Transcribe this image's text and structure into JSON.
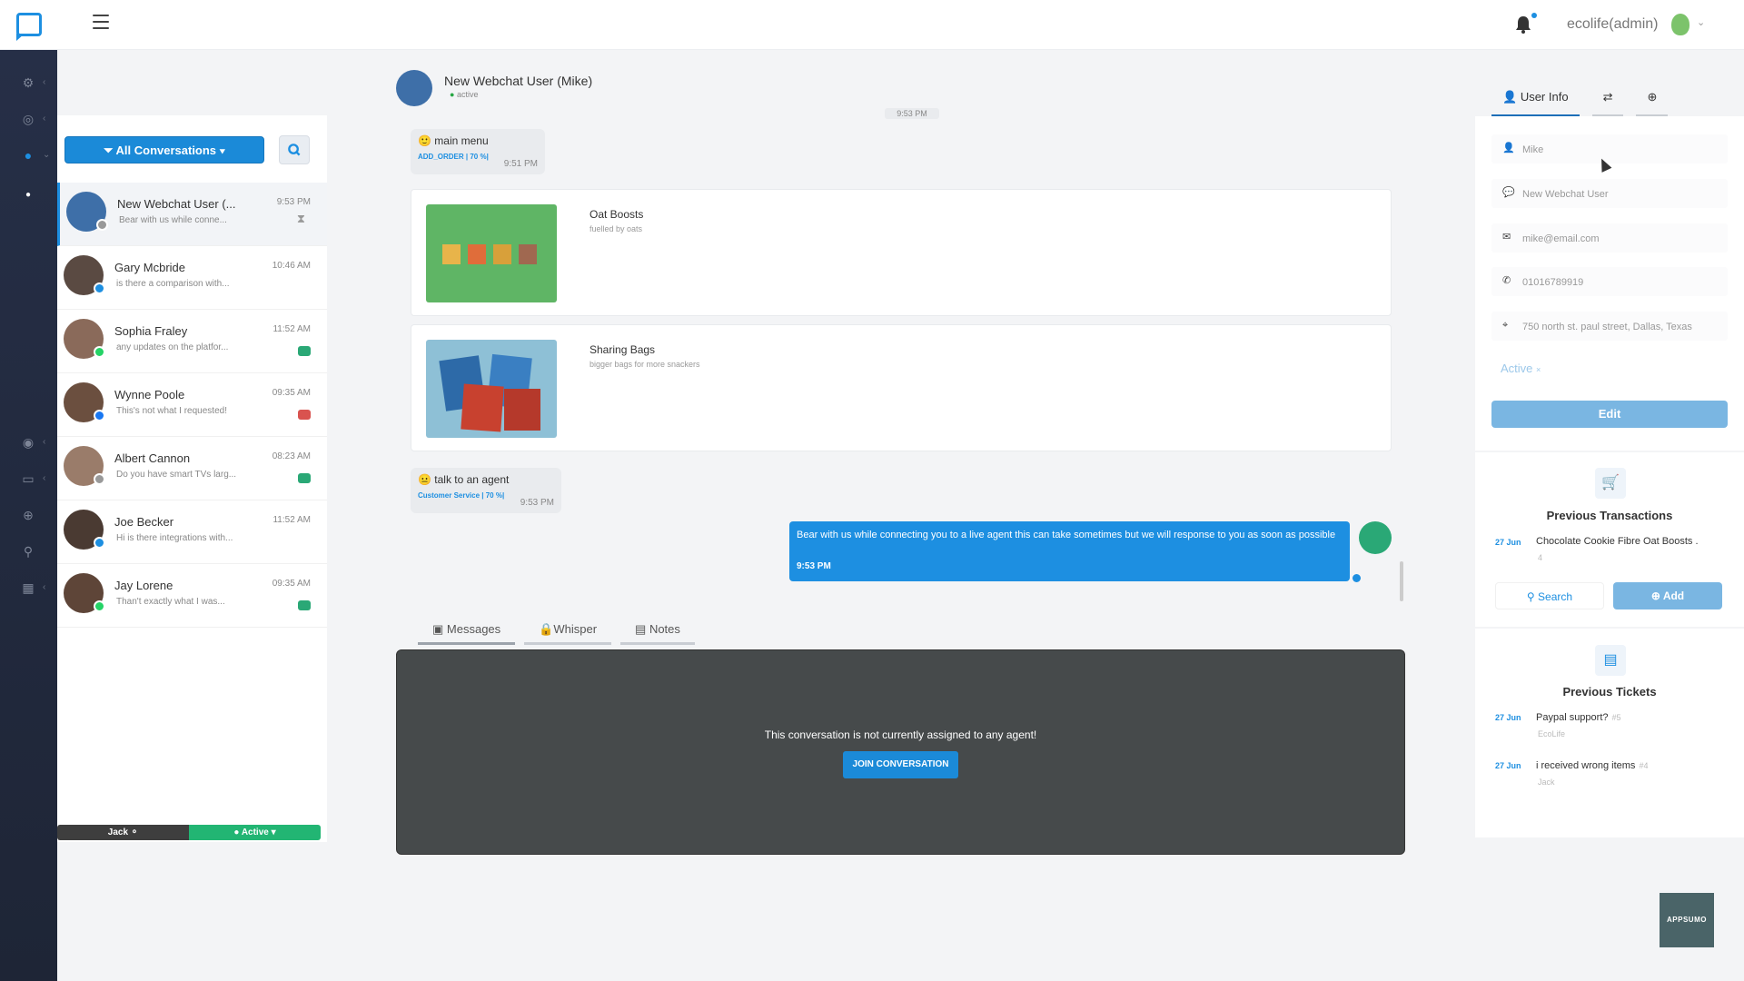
{
  "header": {
    "user_name": "ecolife(admin)",
    "avatar_color": "#7cc36b"
  },
  "conversations": {
    "filter_label": "All Conversations",
    "items": [
      {
        "name": "New Webchat User (...",
        "time": "9:53 PM",
        "preview": "Bear with us while conne...",
        "channel": "webchat",
        "status_icon": "hourglass-icon"
      },
      {
        "name": "Gary Mcbride",
        "time": "10:46 AM",
        "preview": "is there a comparison with...",
        "channel": "messenger",
        "status_icon": ""
      },
      {
        "name": "Sophia Fraley",
        "time": "11:52 AM",
        "preview": "any updates on the platfor...",
        "channel": "whatsapp",
        "status_icon": "bot-icon"
      },
      {
        "name": "Wynne Poole",
        "time": "09:35 AM",
        "preview": "This's not what I requested!",
        "channel": "facebook",
        "status_icon": "bot-icon-red"
      },
      {
        "name": "Albert Cannon",
        "time": "08:23 AM",
        "preview": "Do you have smart TVs larg...",
        "channel": "webchat",
        "status_icon": "bot-icon"
      },
      {
        "name": "Joe Becker",
        "time": "11:52 AM",
        "preview": "Hi is there integrations with...",
        "channel": "messenger",
        "status_icon": ""
      },
      {
        "name": "Jay Lorene",
        "time": "09:35 AM",
        "preview": "Than't exactly what I was...",
        "channel": "whatsapp",
        "status_icon": "bot-icon"
      }
    ],
    "agent_name": "Jack",
    "agent_status": "Active"
  },
  "chat": {
    "title": "New Webchat User (Mike)",
    "status": "active",
    "time_divider": "9:53 PM",
    "msg1": {
      "text": "main menu",
      "sub": "ADD_ORDER | 70 %|",
      "time": "9:51 PM"
    },
    "cards": [
      {
        "title": "Oat Boosts",
        "subtitle": "fuelled by oats"
      },
      {
        "title": "Sharing Bags",
        "subtitle": "bigger bags for more snackers"
      }
    ],
    "msg2": {
      "text": "talk to an agent",
      "sub": "Customer Service | 70 %|",
      "time": "9:53 PM"
    },
    "agent_msg": {
      "text": "Bear with us while connecting you to a live agent this can take sometimes but we will response to you as soon as possible",
      "time": "9:53 PM"
    },
    "tabs": [
      "Messages",
      "Whisper",
      "Notes"
    ],
    "unassigned_text": "This conversation is not currently assigned to any agent!",
    "join_label": "JOIN CONVERSATION"
  },
  "user_info": {
    "tab_label": "User Info",
    "name": "Mike",
    "channel": "New Webchat User",
    "email": "mike@email.com",
    "phone": "01016789919",
    "address": "750 north st. paul street, Dallas, Texas",
    "tag": "Active",
    "edit_label": "Edit"
  },
  "transactions": {
    "title": "Previous Transactions",
    "items": [
      {
        "date": "27 Jun",
        "title": "Chocolate Cookie Fibre Oat Boosts .",
        "sub": "4"
      }
    ],
    "search_label": "Search",
    "add_label": "Add"
  },
  "tickets": {
    "title": "Previous Tickets",
    "items": [
      {
        "date": "27 Jun",
        "title": "Paypal support?",
        "num": "#5",
        "sub": "EcoLife"
      },
      {
        "date": "27 Jun",
        "title": "i received wrong items",
        "num": "#4",
        "sub": "Jack"
      }
    ]
  },
  "appsumo": "APPSUMO",
  "colors": {
    "primary": "#1d8fe1",
    "rail": "#262f47",
    "bot": "#2aa876",
    "composer": "#464a4b"
  }
}
